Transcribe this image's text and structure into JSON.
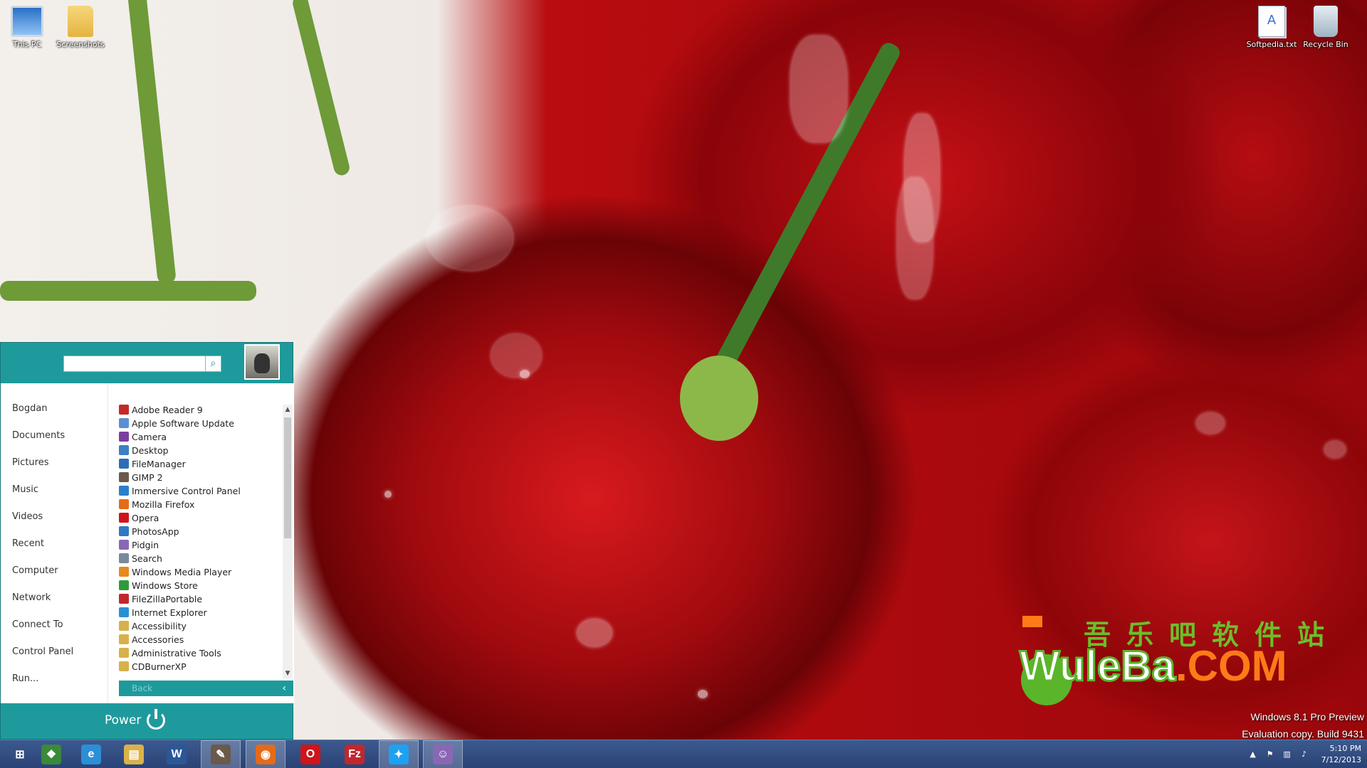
{
  "desktop": {
    "icons": [
      {
        "name": "this-pc-icon",
        "label": "This PC"
      },
      {
        "name": "screenshots-folder-icon",
        "label": "Screenshots"
      },
      {
        "name": "softpedia-txt-icon",
        "label": "Softpedia.txt"
      },
      {
        "name": "recycle-bin-icon",
        "label": "Recycle Bin"
      }
    ],
    "watermark": {
      "chinese": "吾乐吧软件站",
      "logo_w": "WuleBa",
      "logo_c": ".COM"
    },
    "eval_line1": "Windows 8.1 Pro Preview",
    "eval_line2": "Evaluation copy. Build 9431"
  },
  "start_menu": {
    "accent_color": "#1f9a9c",
    "search": {
      "value": "",
      "placeholder": "",
      "button_icon": "search-icon"
    },
    "left_items": [
      "Bogdan",
      "Documents",
      "Pictures",
      "Music",
      "Videos",
      "Recent",
      "Computer",
      "Network",
      "Connect To",
      "Control Panel",
      "Run..."
    ],
    "programs": [
      {
        "label": "Adobe Reader 9",
        "color": "#c62828"
      },
      {
        "label": "Apple Software Update",
        "color": "#5a8fd6"
      },
      {
        "label": "Camera",
        "color": "#7b3fa0"
      },
      {
        "label": "Desktop",
        "color": "#3b7fc4"
      },
      {
        "label": "FileManager",
        "color": "#2d6db5"
      },
      {
        "label": "GIMP 2",
        "color": "#6b5a4a"
      },
      {
        "label": "Immersive Control Panel",
        "color": "#2a7fc9"
      },
      {
        "label": "Mozilla Firefox",
        "color": "#e46b1a"
      },
      {
        "label": "Opera",
        "color": "#d0141b"
      },
      {
        "label": "PhotosApp",
        "color": "#2f78c2"
      },
      {
        "label": "Pidgin",
        "color": "#8a67b5"
      },
      {
        "label": "Search",
        "color": "#7a8a99"
      },
      {
        "label": "Windows Media Player",
        "color": "#e88a1a"
      },
      {
        "label": "Windows Store",
        "color": "#2f9a3a"
      },
      {
        "label": "FileZillaPortable",
        "color": "#c1272d"
      },
      {
        "label": "Internet Explorer",
        "color": "#2b8fd6"
      },
      {
        "label": "Accessibility",
        "color": "#d7b14a"
      },
      {
        "label": "Accessories",
        "color": "#d7b14a"
      },
      {
        "label": "Administrative Tools",
        "color": "#d7b14a"
      },
      {
        "label": "CDBurnerXP",
        "color": "#d7b14a"
      }
    ],
    "back_label": "Back",
    "power_label": "Power"
  },
  "taskbar": {
    "buttons": [
      {
        "name": "start-button",
        "glyph": "⊞",
        "color": "transparent",
        "active": false
      },
      {
        "name": "windows7-orb-button",
        "glyph": "❖",
        "color": "#3a8a3a",
        "active": false
      },
      {
        "name": "internet-explorer-button",
        "glyph": "e",
        "color": "#2b8fd6",
        "active": false
      },
      {
        "name": "file-explorer-button",
        "glyph": "▤",
        "color": "#d9b34a",
        "active": false
      },
      {
        "name": "word-button",
        "glyph": "W",
        "color": "#2b5797",
        "active": false
      },
      {
        "name": "gimp-button",
        "glyph": "✎",
        "color": "#6b5a4a",
        "active": true
      },
      {
        "name": "firefox-button",
        "glyph": "◉",
        "color": "#e46b1a",
        "active": true
      },
      {
        "name": "opera-button",
        "glyph": "O",
        "color": "#d0141b",
        "active": false
      },
      {
        "name": "filezilla-button",
        "glyph": "Fz",
        "color": "#c1272d",
        "active": false
      },
      {
        "name": "twitter-button",
        "glyph": "✦",
        "color": "#1da1f2",
        "active": true
      },
      {
        "name": "pidgin-button",
        "glyph": "☺",
        "color": "#8a67b5",
        "active": true
      }
    ],
    "clock_time": "5:10 PM",
    "clock_date": "7/12/2013"
  }
}
